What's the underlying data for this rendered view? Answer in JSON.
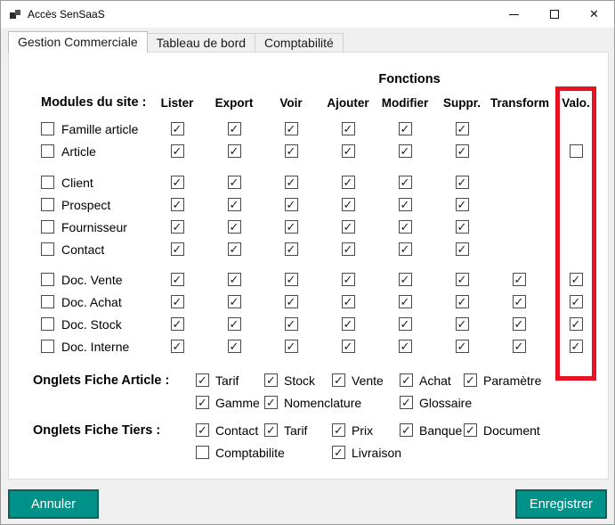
{
  "window": {
    "title": "Accès SenSaaS",
    "controls": {
      "minimize": "minimize",
      "maximize": "maximize",
      "close": "✕"
    }
  },
  "tabs": [
    {
      "label": "Gestion Commerciale",
      "active": true
    },
    {
      "label": "Tableau de bord",
      "active": false
    },
    {
      "label": "Comptabilité",
      "active": false
    }
  ],
  "content": {
    "fonctions_title": "Fonctions",
    "modules_header": "Modules du site :",
    "columns": [
      "Lister",
      "Export",
      "Voir",
      "Ajouter",
      "Modifier",
      "Suppr.",
      "Transform",
      "Valo."
    ],
    "highlighted_column": "Valo.",
    "groups": [
      {
        "rows": [
          {
            "label": "Famille article",
            "module_checked": false,
            "cells": [
              "checked",
              "checked",
              "checked",
              "checked",
              "checked",
              "checked",
              "none",
              "none"
            ]
          },
          {
            "label": "Article",
            "module_checked": false,
            "cells": [
              "checked",
              "checked",
              "checked",
              "checked",
              "checked",
              "checked",
              "none",
              "unchecked"
            ]
          }
        ]
      },
      {
        "rows": [
          {
            "label": "Client",
            "module_checked": false,
            "cells": [
              "checked",
              "checked",
              "checked",
              "checked",
              "checked",
              "checked",
              "none",
              "none"
            ]
          },
          {
            "label": "Prospect",
            "module_checked": false,
            "cells": [
              "checked",
              "checked",
              "checked",
              "checked",
              "checked",
              "checked",
              "none",
              "none"
            ]
          },
          {
            "label": "Fournisseur",
            "module_checked": false,
            "cells": [
              "checked",
              "checked",
              "checked",
              "checked",
              "checked",
              "checked",
              "none",
              "none"
            ]
          },
          {
            "label": "Contact",
            "module_checked": false,
            "cells": [
              "checked",
              "checked",
              "checked",
              "checked",
              "checked",
              "checked",
              "none",
              "none"
            ]
          }
        ]
      },
      {
        "rows": [
          {
            "label": "Doc. Vente",
            "module_checked": false,
            "cells": [
              "checked",
              "checked",
              "checked",
              "checked",
              "checked",
              "checked",
              "checked",
              "checked"
            ]
          },
          {
            "label": "Doc. Achat",
            "module_checked": false,
            "cells": [
              "checked",
              "checked",
              "checked",
              "checked",
              "checked",
              "checked",
              "checked",
              "checked"
            ]
          },
          {
            "label": "Doc. Stock",
            "module_checked": false,
            "cells": [
              "checked",
              "checked",
              "checked",
              "checked",
              "checked",
              "checked",
              "checked",
              "checked"
            ]
          },
          {
            "label": "Doc. Interne",
            "module_checked": false,
            "cells": [
              "checked",
              "checked",
              "checked",
              "checked",
              "checked",
              "checked",
              "checked",
              "checked"
            ]
          }
        ]
      }
    ],
    "onglets_article": {
      "label": "Onglets Fiche Article :",
      "lines": [
        {
          "items": [
            {
              "label": "Tarif",
              "checked": true,
              "col": 1
            },
            {
              "label": "Stock",
              "checked": true,
              "col": 2
            },
            {
              "label": "Vente",
              "checked": true,
              "col": 3
            },
            {
              "label": "Achat",
              "checked": true,
              "col": 4
            },
            {
              "label": "Paramètre",
              "checked": true,
              "col": 5
            }
          ]
        },
        {
          "items": [
            {
              "label": "Gamme",
              "checked": true,
              "col": 1
            },
            {
              "label": "Nomenclature",
              "checked": true,
              "col": 2
            },
            {
              "label": "Glossaire",
              "checked": true,
              "col": 4
            }
          ]
        }
      ]
    },
    "onglets_tiers": {
      "label": "Onglets Fiche Tiers :",
      "lines": [
        {
          "items": [
            {
              "label": "Contact",
              "checked": true,
              "col": 1
            },
            {
              "label": "Tarif",
              "checked": true,
              "col": 2
            },
            {
              "label": "Prix",
              "checked": true,
              "col": 3
            },
            {
              "label": "Banque",
              "checked": true,
              "col": 4
            },
            {
              "label": "Document",
              "checked": true,
              "col": 5
            }
          ]
        },
        {
          "items": [
            {
              "label": "Comptabilite",
              "checked": false,
              "col": 1
            },
            {
              "label": "Livraison",
              "checked": true,
              "col": 3
            }
          ]
        }
      ]
    }
  },
  "buttons": {
    "cancel": "Annuler",
    "save": "Enregistrer"
  },
  "colors": {
    "accent": "#009289",
    "accent_border": "#04655E",
    "highlight_red": "#E81123"
  }
}
